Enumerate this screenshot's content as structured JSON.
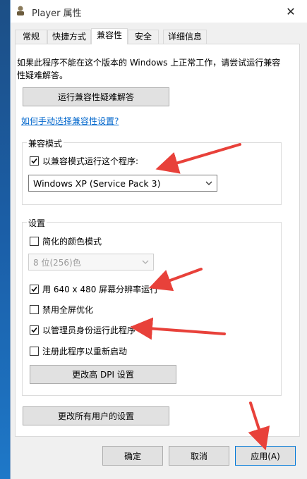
{
  "window": {
    "title": "Player 属性",
    "close_glyph": "✕"
  },
  "tabs": [
    {
      "label": "常规"
    },
    {
      "label": "快捷方式"
    },
    {
      "label": "兼容性"
    },
    {
      "label": "安全"
    },
    {
      "label": "详细信息"
    }
  ],
  "intro": {
    "text": "如果此程序不能在这个版本的 Windows 上正常工作，请尝试运行兼容性疑难解答。"
  },
  "troubleshoot_button": "运行兼容性疑难解答",
  "manual_link": "如何手动选择兼容性设置?",
  "compat_mode": {
    "group_label": "兼容模式",
    "checkbox_label": "以兼容模式运行这个程序:",
    "checked": true,
    "selected_os": "Windows XP (Service Pack 3)"
  },
  "settings": {
    "group_label": "设置",
    "reduced_color": {
      "label": "简化的颜色模式",
      "checked": false
    },
    "color_select": "8 位(256)色",
    "run_640": {
      "label": "用 640 x 480 屏幕分辨率运行",
      "checked": true
    },
    "disable_fullscreen": {
      "label": "禁用全屏优化",
      "checked": false
    },
    "run_as_admin": {
      "label": "以管理员身份运行此程序",
      "checked": true
    },
    "register_restart": {
      "label": "注册此程序以重新启动",
      "checked": false
    },
    "dpi_button": "更改高 DPI 设置"
  },
  "all_users_button": "更改所有用户的设置",
  "footer": {
    "ok": "确定",
    "cancel": "取消",
    "apply": "应用(A)"
  },
  "colors": {
    "accent_link": "#0066cc",
    "annotation_arrow": "#e8413a"
  },
  "icons": {
    "title_icon": "player-app-icon",
    "close": "close-icon",
    "dropdown": "chevron-down-icon",
    "check": "checkmark-icon"
  }
}
